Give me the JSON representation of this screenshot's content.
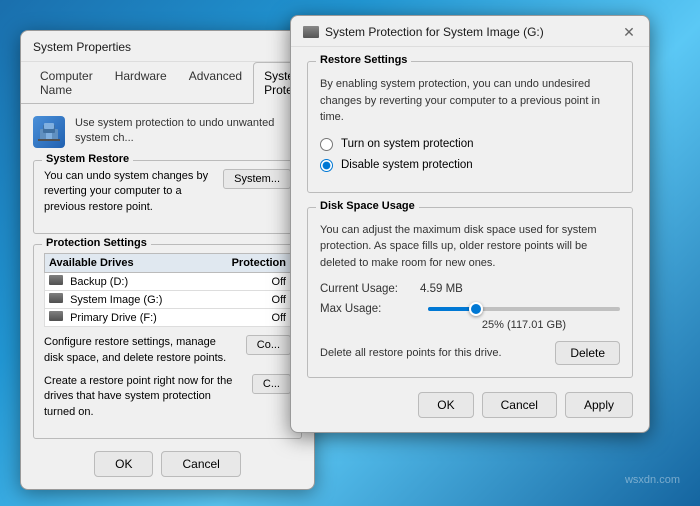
{
  "watermark": "wsxdn.com",
  "system_props": {
    "title": "System Properties",
    "tabs": [
      {
        "id": "computer-name",
        "label": "Computer Name",
        "active": false
      },
      {
        "id": "hardware",
        "label": "Hardware",
        "active": false
      },
      {
        "id": "advanced",
        "label": "Advanced",
        "active": false
      },
      {
        "id": "system-protection",
        "label": "System Protection",
        "active": true
      }
    ],
    "info_text": "Use system protection to undo unwanted system ch...",
    "sections": {
      "system_restore": {
        "title": "System Restore",
        "description": "You can undo system changes by reverting your computer to a previous restore point.",
        "button": "System..."
      },
      "protection_settings": {
        "title": "Protection Settings",
        "table_headers": [
          "Available Drives",
          "Protection"
        ],
        "drives": [
          {
            "name": "Backup (D:)",
            "protection": "Off"
          },
          {
            "name": "System Image (G:)",
            "protection": "Off"
          },
          {
            "name": "Primary Drive (F:)",
            "protection": "Off"
          }
        ],
        "configure_text": "Configure restore settings, manage disk space, and delete restore points.",
        "configure_btn": "Co...",
        "create_text": "Create a restore point right now for the drives that have system protection turned on.",
        "create_btn": "C..."
      }
    },
    "bottom_buttons": {
      "ok": "OK",
      "cancel": "Cancel"
    }
  },
  "sys_protection": {
    "title": "System Protection for System Image (G:)",
    "sections": {
      "restore_settings": {
        "title": "Restore Settings",
        "description": "By enabling system protection, you can undo undesired changes by reverting your computer to a previous point in time.",
        "options": [
          {
            "id": "turn-on",
            "label": "Turn on system protection",
            "checked": false
          },
          {
            "id": "disable",
            "label": "Disable system protection",
            "checked": true
          }
        ]
      },
      "disk_space": {
        "title": "Disk Space Usage",
        "description": "You can adjust the maximum disk space used for system protection. As space fills up, older restore points will be deleted to make room for new ones.",
        "current_usage_label": "Current Usage:",
        "current_usage_value": "4.59 MB",
        "max_usage_label": "Max Usage:",
        "slider_percent": "25% (117.01 GB)",
        "delete_text": "Delete all restore points for this drive.",
        "delete_btn": "Delete"
      }
    },
    "bottom_buttons": {
      "ok": "OK",
      "cancel": "Cancel",
      "apply": "Apply"
    }
  }
}
